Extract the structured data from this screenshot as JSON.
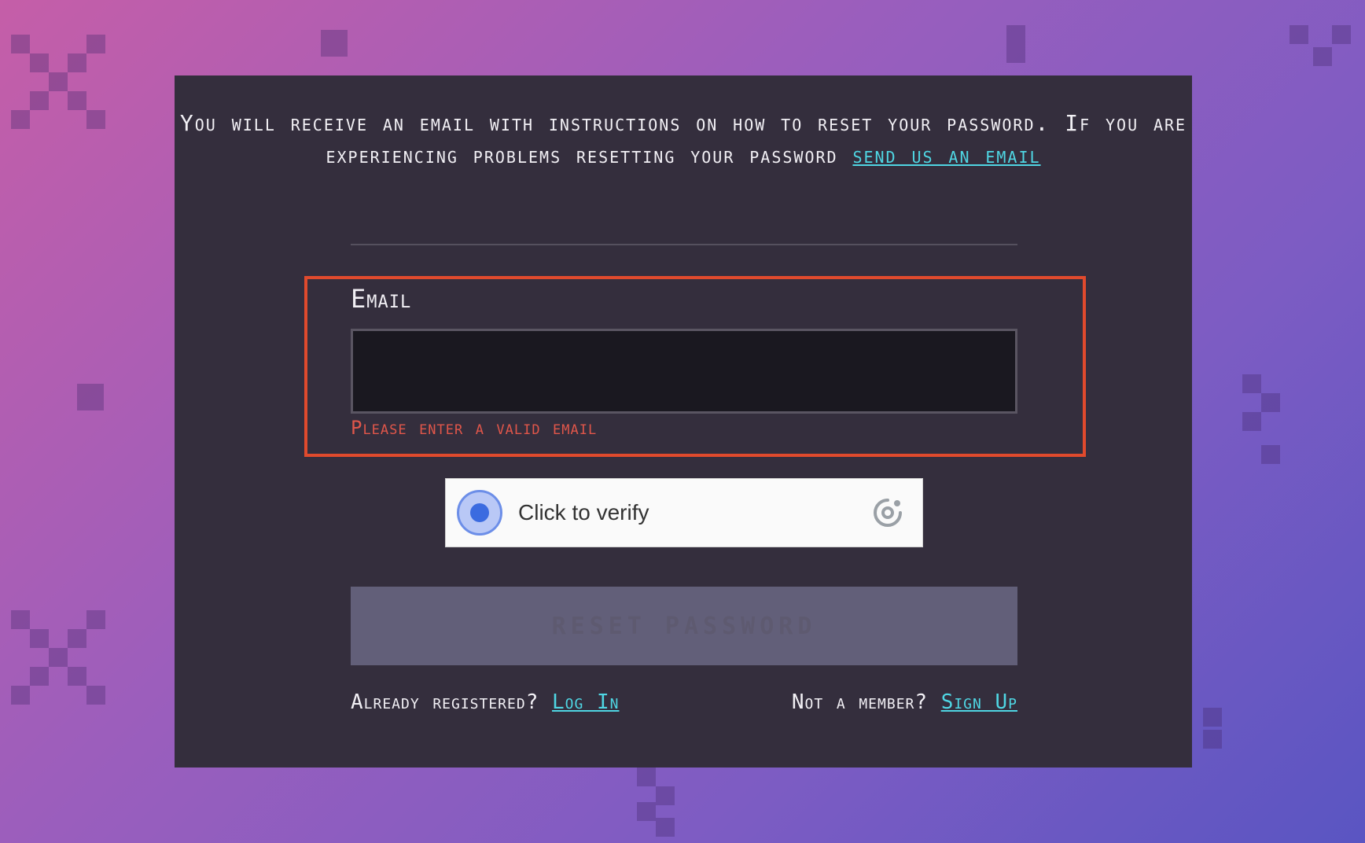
{
  "intro": {
    "text": "You will receive an email with instructions on how to reset your password. If you are experiencing problems resetting your password",
    "link": "send us an email"
  },
  "form": {
    "email_label": "Email",
    "email_value": "",
    "error": "Please enter a valid email"
  },
  "captcha": {
    "label": "Click to verify"
  },
  "reset_button": "Reset Password",
  "footer": {
    "login_prompt": "Already registered?",
    "login_link": "Log In",
    "signup_prompt": "Not a member?",
    "signup_link": "Sign Up"
  },
  "colors": {
    "card": "#342e3d",
    "accent_link": "#4fd6e3",
    "error": "#e04a2d"
  }
}
